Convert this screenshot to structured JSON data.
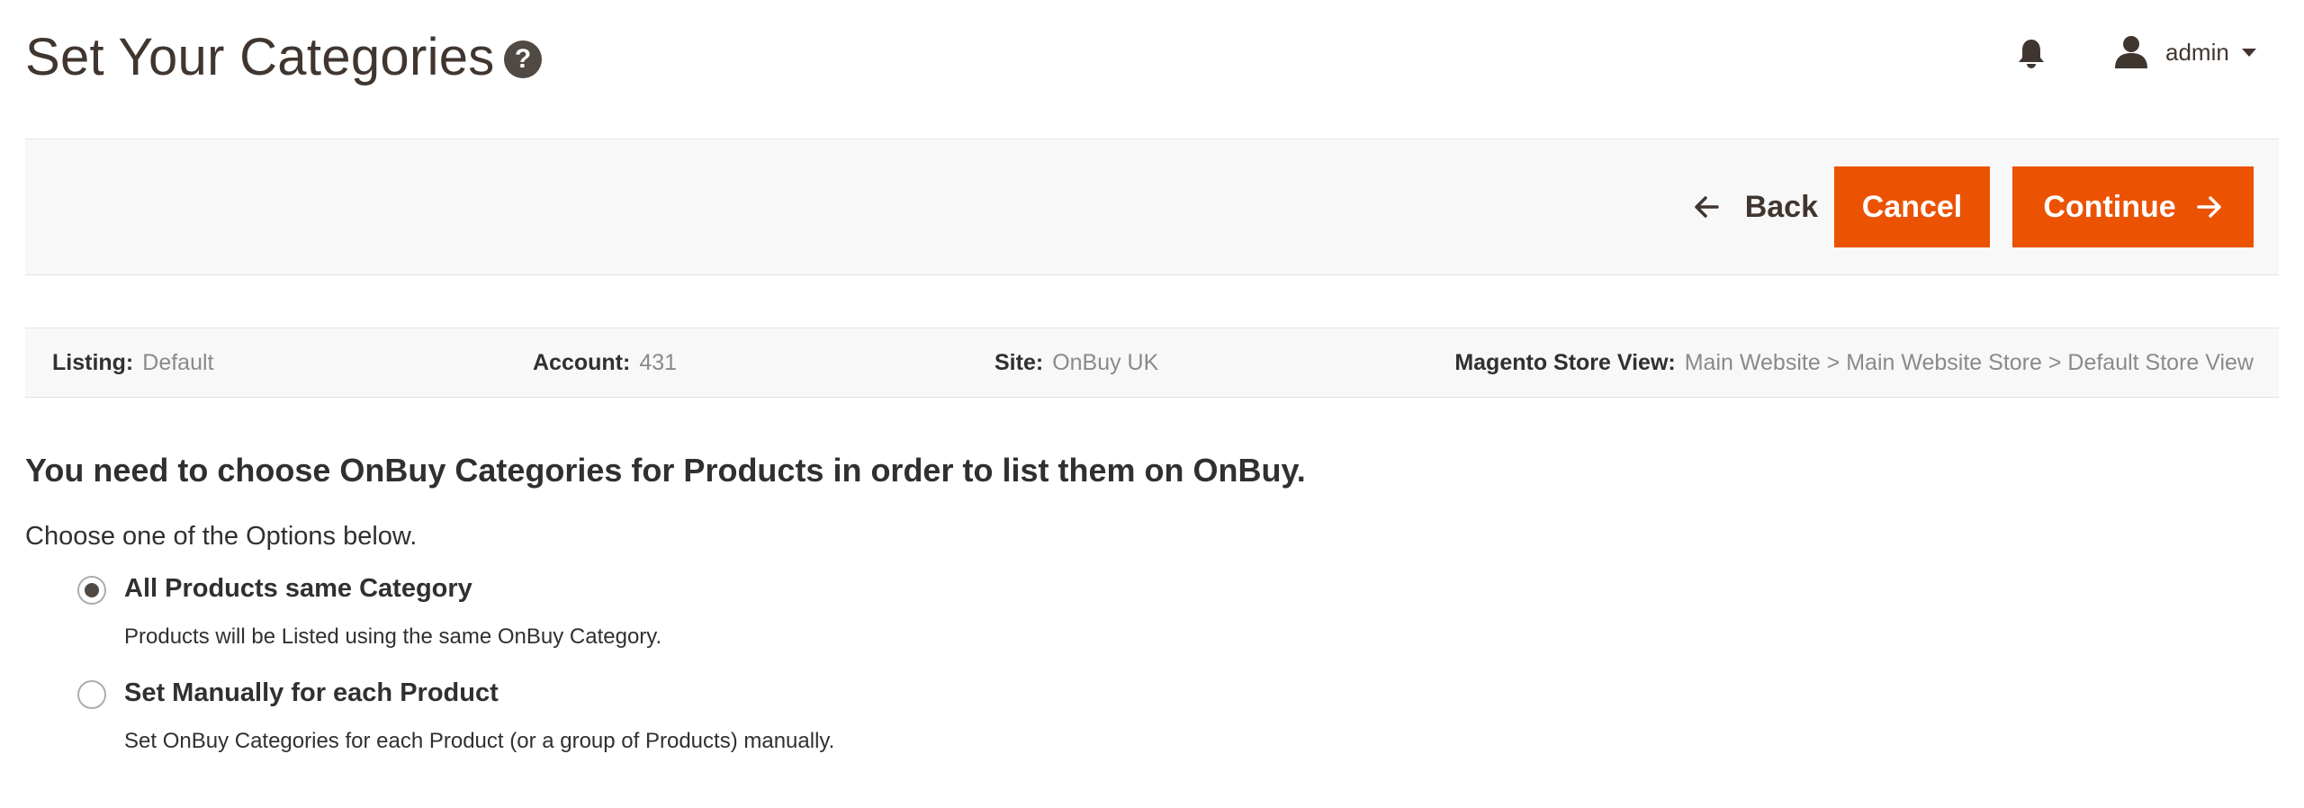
{
  "header": {
    "title": "Set Your Categories",
    "help_icon": "question-circle-icon",
    "help_glyph": "?",
    "user": "admin"
  },
  "actions": {
    "back_label": "Back",
    "cancel_label": "Cancel",
    "continue_label": "Continue"
  },
  "info": {
    "listing_label": "Listing:",
    "listing_value": "Default",
    "account_label": "Account:",
    "account_value": "431",
    "site_label": "Site:",
    "site_value": "OnBuy UK",
    "store_label": "Magento Store View:",
    "store_value": "Main Website > Main Website Store > Default Store View"
  },
  "content": {
    "heading": "You need to choose OnBuy Categories for Products in order to list them on OnBuy.",
    "intro": "Choose one of the Options below.",
    "options": [
      {
        "label": "All Products same Category",
        "note": "Products will be Listed using the same OnBuy Category.",
        "selected": true
      },
      {
        "label": "Set Manually for each Product",
        "note": "Set OnBuy Categories for each Product (or a group of Products) manually.",
        "selected": false
      }
    ]
  },
  "colors": {
    "accent": "#eb5202",
    "title": "#41362f",
    "muted": "#8a8a8a"
  }
}
